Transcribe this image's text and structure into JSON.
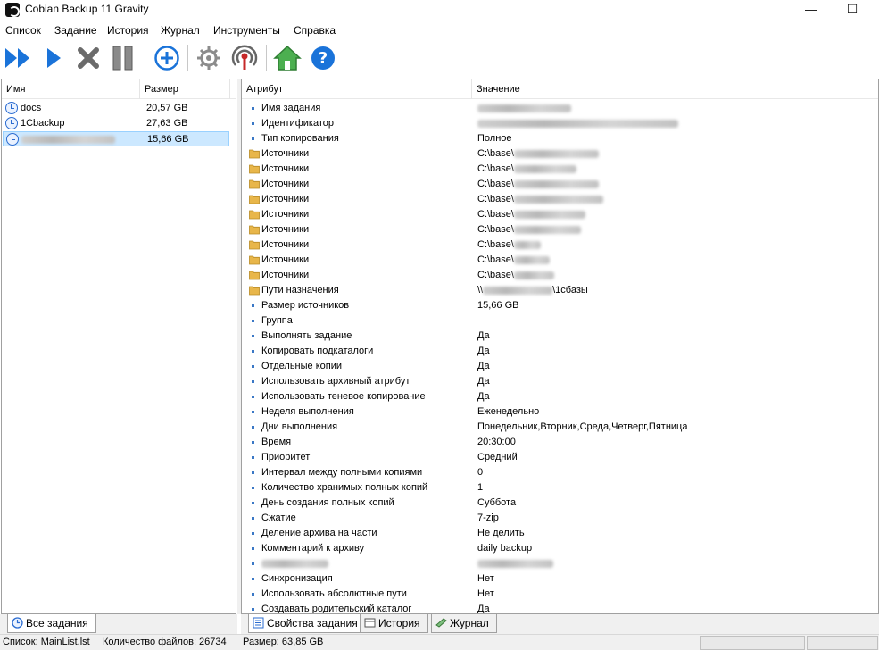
{
  "window": {
    "title": "Cobian Backup 11 Gravity"
  },
  "menu": [
    "Список",
    "Задание",
    "История",
    "Журнал",
    "Инструменты",
    "Справка"
  ],
  "toolbar": [
    {
      "name": "run-all-button",
      "icon": "fast-forward-icon"
    },
    {
      "name": "run-selected-button",
      "icon": "play-icon"
    },
    {
      "name": "cancel-button",
      "icon": "cross-icon"
    },
    {
      "name": "pause-button",
      "icon": "pause-icon"
    },
    {
      "name": "add-task-button",
      "icon": "plus-circle-icon"
    },
    {
      "name": "settings-button",
      "icon": "gear-icon"
    },
    {
      "name": "monitor-button",
      "icon": "antenna-icon"
    },
    {
      "name": "home-button",
      "icon": "home-icon"
    },
    {
      "name": "help-button",
      "icon": "help-icon"
    }
  ],
  "tasks": {
    "headers": {
      "name": "Имя",
      "size": "Размер"
    },
    "rows": [
      {
        "name": "docs",
        "size": "20,57 GB",
        "selected": false,
        "redacted": false
      },
      {
        "name": "1Cbackup",
        "size": "27,63 GB",
        "selected": false,
        "redacted": false
      },
      {
        "name": "",
        "size": "15,66 GB",
        "selected": true,
        "redacted": true
      }
    ]
  },
  "properties": {
    "headers": {
      "attr": "Атрибут",
      "value": "Значение"
    },
    "rows": [
      {
        "icon": "bullet",
        "name": "Имя задания",
        "value": "",
        "redact_value": true
      },
      {
        "icon": "bullet",
        "name": "Идентификатор",
        "value": "",
        "redact_value": true
      },
      {
        "icon": "bullet",
        "name": "Тип копирования",
        "value": "Полное"
      },
      {
        "icon": "folder",
        "name": "Источники",
        "value": "C:\\base\\",
        "redact_suffix": true
      },
      {
        "icon": "folder",
        "name": "Источники",
        "value": "C:\\base\\",
        "redact_suffix": true
      },
      {
        "icon": "folder",
        "name": "Источники",
        "value": "C:\\base\\",
        "redact_suffix": true
      },
      {
        "icon": "folder",
        "name": "Источники",
        "value": "C:\\base\\",
        "redact_suffix": true
      },
      {
        "icon": "folder",
        "name": "Источники",
        "value": "C:\\base\\",
        "redact_suffix": true
      },
      {
        "icon": "folder",
        "name": "Источники",
        "value": "C:\\base\\",
        "redact_suffix": true
      },
      {
        "icon": "folder",
        "name": "Источники",
        "value": "C:\\base\\",
        "redact_suffix": true
      },
      {
        "icon": "folder",
        "name": "Источники",
        "value": "C:\\base\\",
        "redact_suffix": true
      },
      {
        "icon": "folder",
        "name": "Источники",
        "value": "C:\\base\\",
        "redact_suffix": true
      },
      {
        "icon": "folder",
        "name": "Пути назначения",
        "value": "\\\\",
        "redact_middle": true,
        "value_tail": "\\1сбазы"
      },
      {
        "icon": "bullet",
        "name": "Размер источников",
        "value": "15,66 GB"
      },
      {
        "icon": "bullet",
        "name": "Группа",
        "value": ""
      },
      {
        "icon": "bullet",
        "name": "Выполнять задание",
        "value": "Да"
      },
      {
        "icon": "bullet",
        "name": "Копировать подкаталоги",
        "value": "Да"
      },
      {
        "icon": "bullet",
        "name": "Отдельные копии",
        "value": "Да"
      },
      {
        "icon": "bullet",
        "name": "Использовать архивный атрибут",
        "value": "Да"
      },
      {
        "icon": "bullet",
        "name": "Использовать теневое копирование",
        "value": "Да"
      },
      {
        "icon": "bullet",
        "name": "Неделя выполнения",
        "value": "Еженедельно"
      },
      {
        "icon": "bullet",
        "name": "Дни выполнения",
        "value": "Понедельник,Вторник,Среда,Четверг,Пятница"
      },
      {
        "icon": "bullet",
        "name": "Время",
        "value": "20:30:00"
      },
      {
        "icon": "bullet",
        "name": "Приоритет",
        "value": "Средний"
      },
      {
        "icon": "bullet",
        "name": "Интервал между полными копиями",
        "value": "0"
      },
      {
        "icon": "bullet",
        "name": "Количество хранимых полных копий",
        "value": "1"
      },
      {
        "icon": "bullet",
        "name": "День создания полных копий",
        "value": "Суббота"
      },
      {
        "icon": "bullet",
        "name": "Сжатие",
        "value": "7-zip"
      },
      {
        "icon": "bullet",
        "name": "Деление архива на части",
        "value": "Не делить"
      },
      {
        "icon": "bullet",
        "name": "Комментарий к архиву",
        "value": "daily backup"
      },
      {
        "icon": "bullet",
        "name": "",
        "value": "",
        "redact_name": true,
        "redact_value": true
      },
      {
        "icon": "bullet",
        "name": "Синхронизация",
        "value": "Нет"
      },
      {
        "icon": "bullet",
        "name": "Использовать абсолютные пути",
        "value": "Нет"
      },
      {
        "icon": "bullet",
        "name": "Создавать родительский каталог",
        "value": "Да"
      }
    ]
  },
  "tabs": {
    "left": [
      {
        "label": "Все задания",
        "icon": "clock-icon"
      }
    ],
    "right": [
      {
        "label": "Свойства задания",
        "icon": "properties-icon",
        "active": true
      },
      {
        "label": "История",
        "icon": "history-icon",
        "active": false
      },
      {
        "label": "Журнал",
        "icon": "log-icon",
        "active": false
      }
    ]
  },
  "status": {
    "list": "Список: MainList.lst",
    "files": "Количество файлов: 26734",
    "size": "Размер: 63,85 GB"
  },
  "colors": {
    "accent_blue": "#1a73d9",
    "selection": "#cce8ff",
    "bullet": "#3a78c6",
    "folder": "#e8b64a"
  }
}
